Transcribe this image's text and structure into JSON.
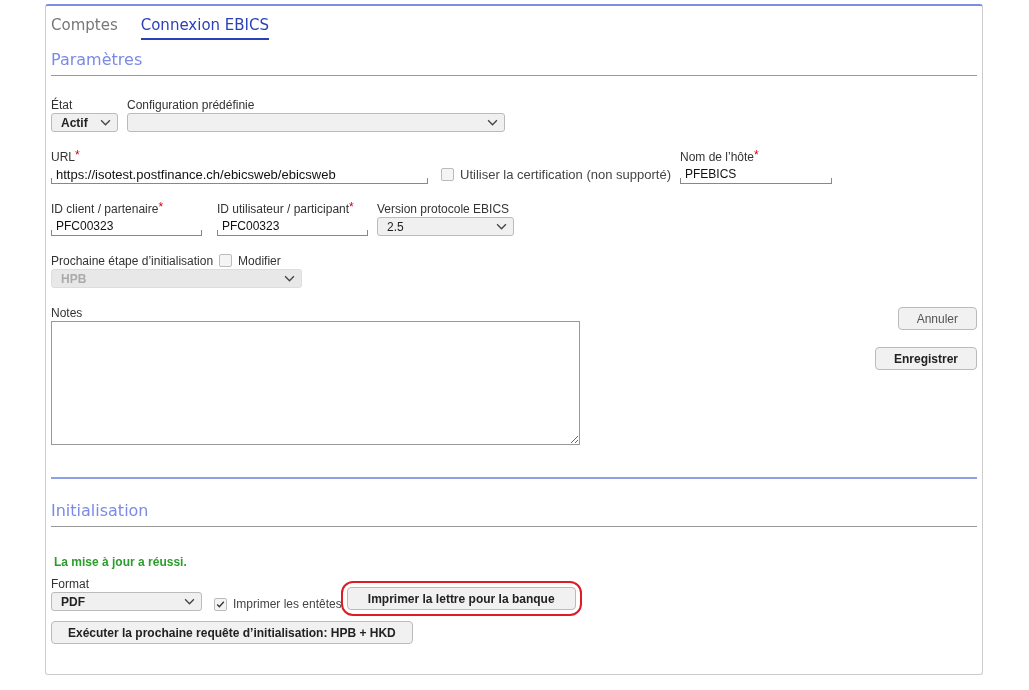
{
  "tabs": [
    {
      "label": "Comptes",
      "selected": false
    },
    {
      "label": "Connexion EBICS",
      "selected": true
    }
  ],
  "parametres": {
    "title": "Paramètres",
    "etat": {
      "label": "État",
      "value": "Actif"
    },
    "configuration": {
      "label": "Configuration prédéfinie"
    },
    "url": {
      "label": "URL",
      "required": "*",
      "value": "https://isotest.postfinance.ch/ebicsweb/ebicsweb"
    },
    "certification": {
      "label": "Utiliser la certification (non supporté)",
      "checked": false
    },
    "host": {
      "label": "Nom de l’hôte",
      "required": "*",
      "value": "PFEBICS"
    },
    "client_id": {
      "label": "ID client / partenaire",
      "required": "*",
      "value": "PFC00323"
    },
    "user_id": {
      "label": "ID utilisateur / participant",
      "required": "*",
      "value": "PFC00323"
    },
    "version": {
      "label": "Version protocole EBICS",
      "value": "2.5"
    },
    "next_step": {
      "label": "Prochaine étape d’initialisation",
      "modify_label": "Modifier",
      "modify_checked": false,
      "value": "HPB",
      "disabled": true
    },
    "notes": {
      "label": "Notes"
    },
    "buttons": [
      {
        "label": "Annuler",
        "bold": false
      },
      {
        "label": "Enregistrer",
        "bold": true
      }
    ]
  },
  "initialisation": {
    "title": "Initialisation",
    "message": "La mise à jour a réussi.",
    "format": {
      "label": "Format",
      "value": "PDF"
    },
    "headers": {
      "label": "Imprimer les entêtes",
      "checked": true
    },
    "print_button": {
      "label": "Imprimer la lettre pour la banque",
      "highlighted": true
    },
    "execute_button": {
      "label": "Exécuter la prochaine requête d’initialisation: HPB + HKD"
    }
  }
}
